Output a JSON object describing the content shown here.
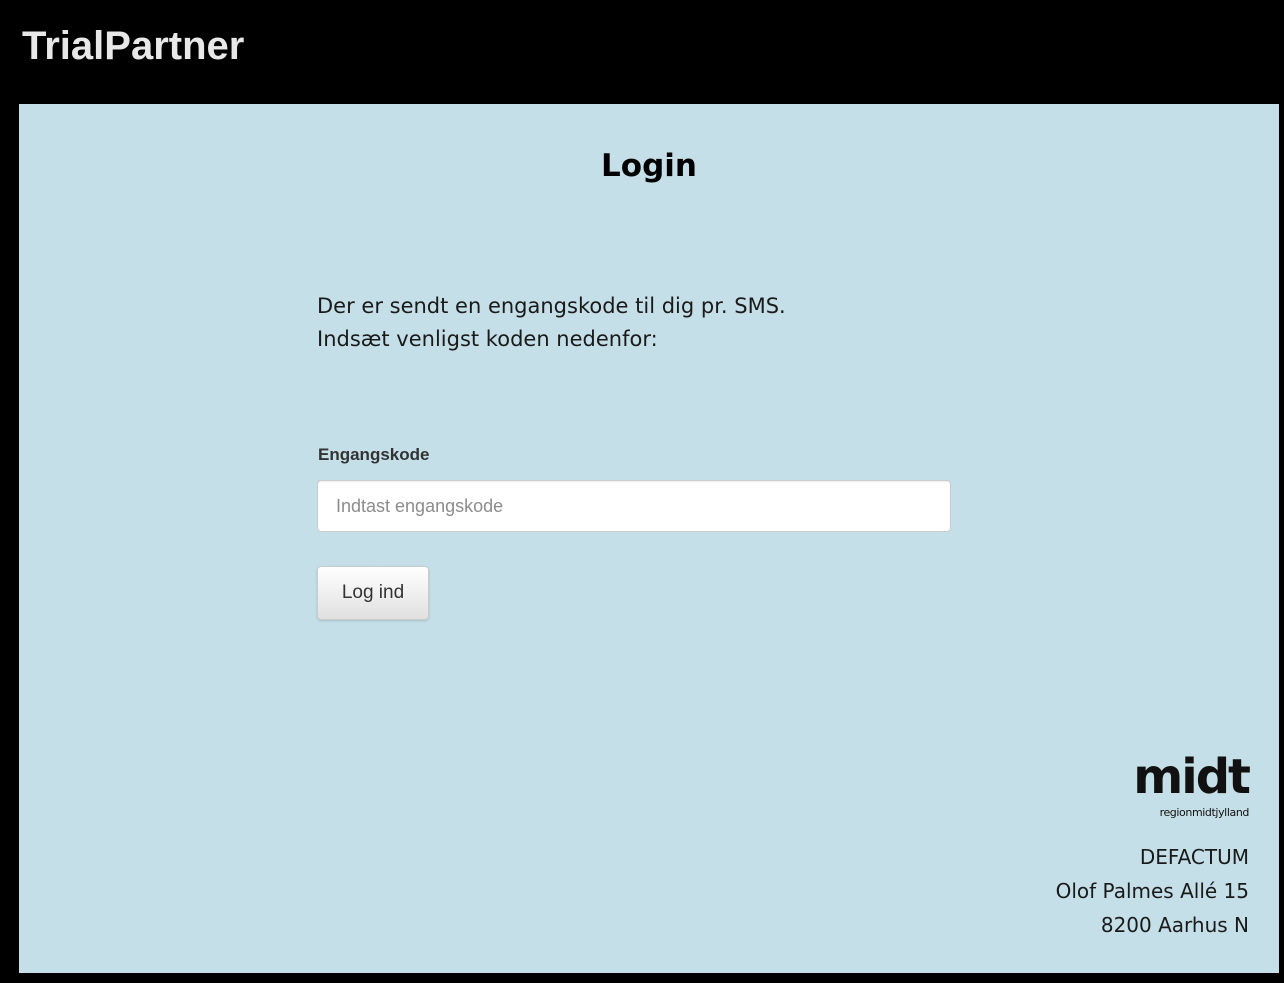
{
  "app": {
    "brand": "TrialPartner"
  },
  "login": {
    "title": "Login",
    "intro_line1": "Der er sendt en engangskode til dig pr. SMS.",
    "intro_line2": "Indsæt venligst koden nedenfor:",
    "field_label": "Engangskode",
    "field_value": "",
    "field_placeholder": "Indtast engangskode",
    "submit_label": "Log ind"
  },
  "footer": {
    "logo_word": "midt",
    "logo_subtext": "regionmidtjylland",
    "address": {
      "org": "DEFACTUM",
      "street": "Olof Palmes Allé 15",
      "city": "8200 Aarhus N"
    }
  },
  "colors": {
    "header_bg": "#000000",
    "content_bg": "#c4dfe7",
    "brand_text": "#e8e8e8"
  }
}
